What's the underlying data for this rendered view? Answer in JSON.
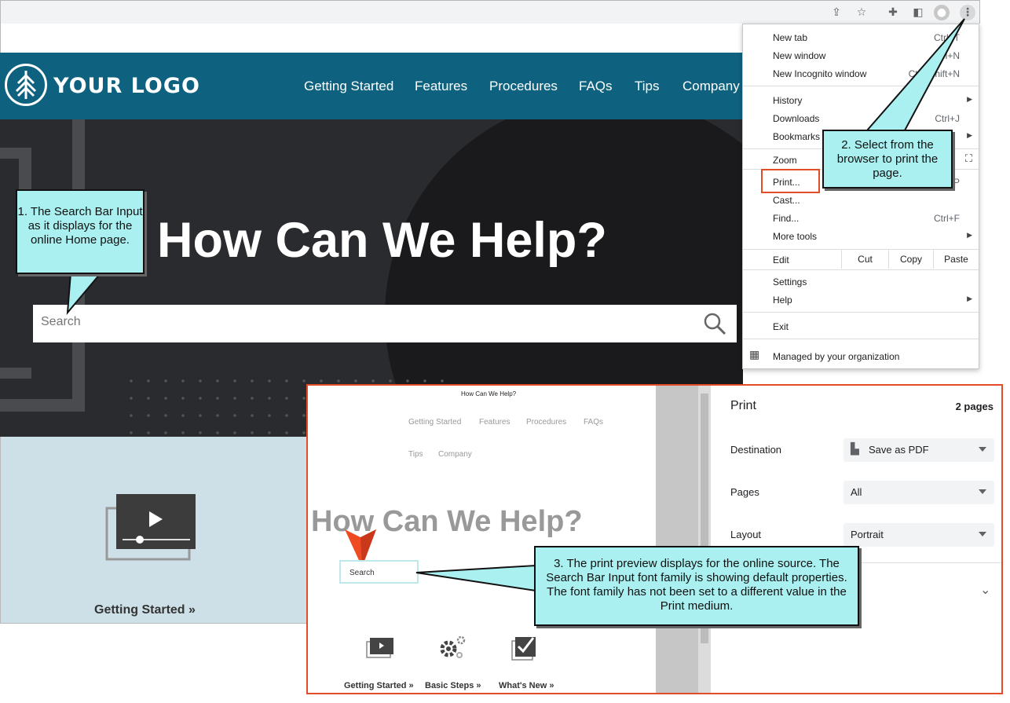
{
  "site": {
    "logo_text": "YOUR LOGO",
    "nav": [
      "Getting Started",
      "Features",
      "Procedures",
      "FAQs",
      "Tips",
      "Company"
    ],
    "hero_title": "How Can We Help?",
    "search_placeholder": "Search",
    "tile_label": "Getting Started »"
  },
  "chrome_menu": {
    "items": [
      {
        "label": "New tab",
        "shortcut": "Ctrl+T"
      },
      {
        "label": "New window",
        "shortcut": "Ctrl+N"
      },
      {
        "label": "New Incognito window",
        "shortcut": "Ctrl+Shift+N"
      },
      {
        "label": "History",
        "shortcut": ""
      },
      {
        "label": "Downloads",
        "shortcut": "Ctrl+J"
      },
      {
        "label": "Bookmarks",
        "shortcut": ""
      },
      {
        "label": "Zoom",
        "shortcut": ""
      },
      {
        "label": "Print...",
        "shortcut": "Ctrl+P"
      },
      {
        "label": "Cast...",
        "shortcut": ""
      },
      {
        "label": "Find...",
        "shortcut": "Ctrl+F"
      },
      {
        "label": "More tools",
        "shortcut": ""
      },
      {
        "label": "Edit",
        "shortcut": ""
      },
      {
        "label": "Settings",
        "shortcut": ""
      },
      {
        "label": "Help",
        "shortcut": ""
      },
      {
        "label": "Exit",
        "shortcut": ""
      },
      {
        "label": "Managed by your organization",
        "shortcut": ""
      }
    ],
    "edit_buttons": [
      "Cut",
      "Copy",
      "Paste"
    ]
  },
  "callouts": {
    "one": "1. The Search Bar Input as it displays for the online Home page.",
    "two": "2. Select from the browser to print the page.",
    "three": "3. The print preview displays for the online source. The Search Bar Input font family is showing default properties. The font family has not been set to a different value in the Print medium."
  },
  "print_preview": {
    "page_header": "How Can We Help?",
    "nav_row1": [
      "Getting Started",
      "Features",
      "Procedures",
      "FAQs"
    ],
    "nav_row2": [
      "Tips",
      "Company"
    ],
    "title": "How Can We Help?",
    "search_text": "Search",
    "tiles": [
      "Getting Started »",
      "Basic Steps »",
      "What's New »"
    ],
    "settings": {
      "heading": "Print",
      "pages_count": "2 pages",
      "destination_label": "Destination",
      "destination_value": "Save as PDF",
      "pages_label": "Pages",
      "pages_value": "All",
      "layout_label": "Layout",
      "layout_value": "Portrait"
    }
  },
  "colors": {
    "header": "#0f627f",
    "callout_fill": "#aaf0f0",
    "highlight": "#e24c26"
  }
}
